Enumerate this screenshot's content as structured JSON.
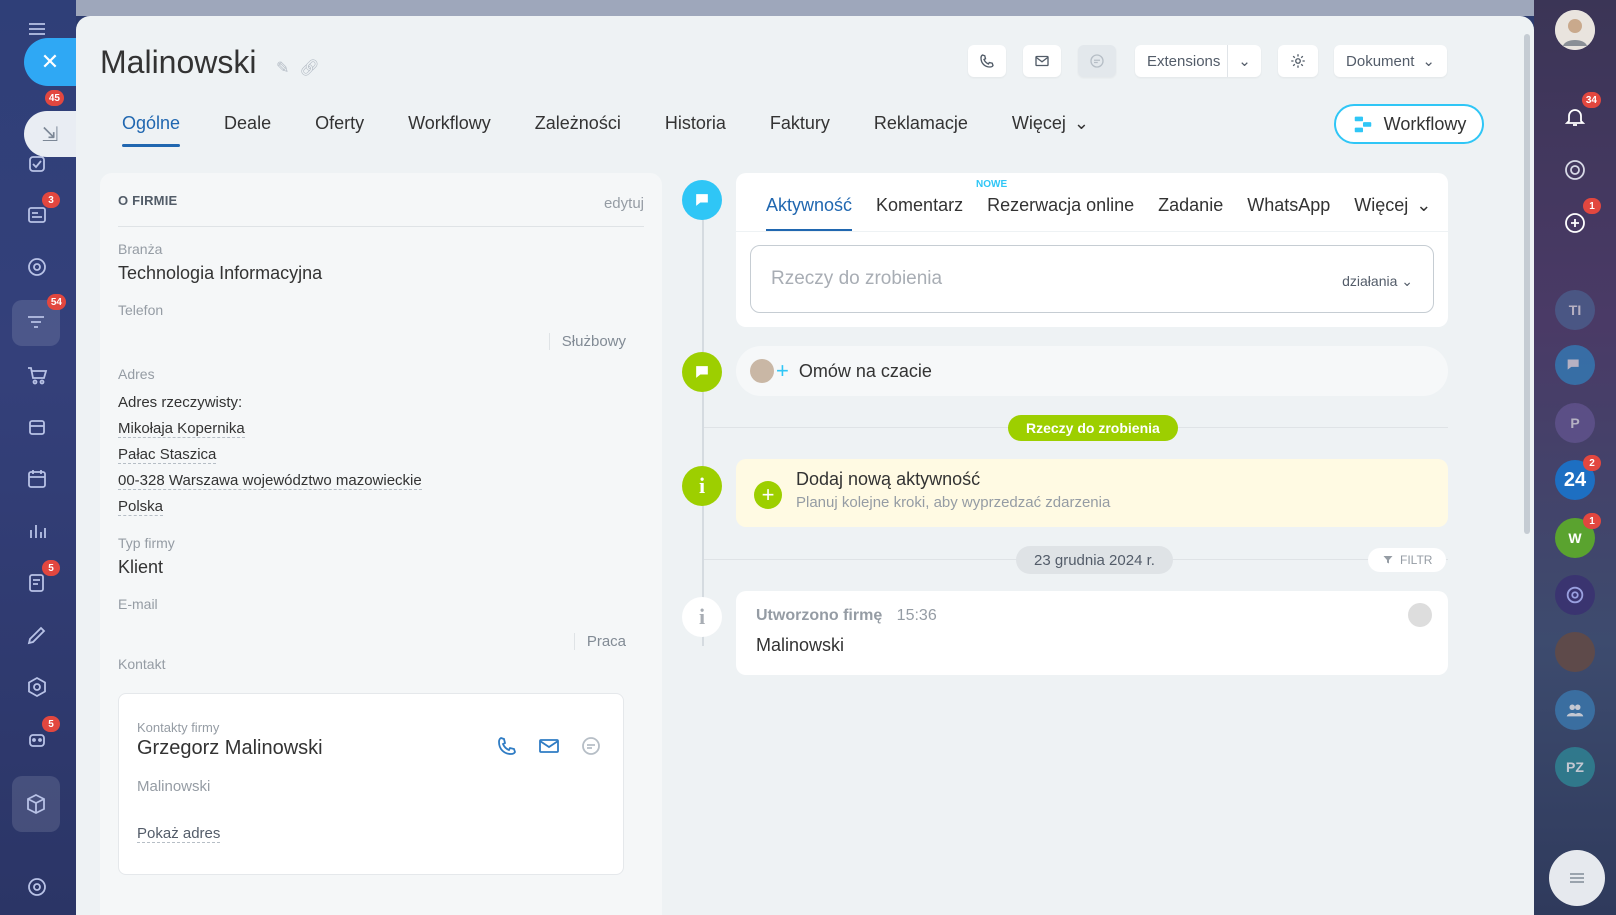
{
  "entity": {
    "title": "Malinowski"
  },
  "header": {
    "extensions_label": "Extensions",
    "document_label": "Dokument"
  },
  "tabs": [
    {
      "label": "Ogólne"
    },
    {
      "label": "Deale"
    },
    {
      "label": "Oferty"
    },
    {
      "label": "Workflowy"
    },
    {
      "label": "Zależności"
    },
    {
      "label": "Historia"
    },
    {
      "label": "Faktury"
    },
    {
      "label": "Reklamacje"
    },
    {
      "label": "Więcej"
    }
  ],
  "workflow_button": "Workflowy",
  "left_sidebar": {
    "badges": {
      "b1": "45",
      "b2": "3",
      "b3": "54",
      "b4": "5",
      "b5": "5"
    }
  },
  "right_sidebar": {
    "notif_badge": "34",
    "chat_badge": "1",
    "b24_badge": "2",
    "w_badge": "1",
    "avatars": {
      "ti": "TI",
      "p": "P",
      "b24": "24",
      "w": "W",
      "pz": "PZ"
    }
  },
  "company": {
    "section_title": "O FIRMIE",
    "edit_label": "edytuj",
    "industry_label": "Branża",
    "industry_value": "Technologia Informacyjna",
    "phone_label": "Telefon",
    "phone_type": "Służbowy",
    "address_label": "Adres",
    "address_sub": "Adres rzeczywisty:",
    "address_lines": [
      "Mikołaja Kopernika",
      "Pałac Staszica",
      "00-328 Warszawa województwo mazowieckie",
      "Polska"
    ],
    "type_label": "Typ firmy",
    "type_value": "Klient",
    "email_label": "E-mail",
    "email_type": "Praca",
    "contact_label": "Kontakt",
    "contact": {
      "box_label": "Kontakty firmy",
      "name": "Grzegorz Malinowski",
      "company": "Malinowski",
      "show_address": "Pokaż adres"
    }
  },
  "activity": {
    "tabs": [
      {
        "label": "Aktywność"
      },
      {
        "label": "Komentarz"
      },
      {
        "label": "Rezerwacja online"
      },
      {
        "label": "Zadanie"
      },
      {
        "label": "WhatsApp"
      },
      {
        "label": "Więcej"
      }
    ],
    "new_tag": "NOWE",
    "input_placeholder": "Rzeczy do zrobienia",
    "actions_label": "działania"
  },
  "chat": {
    "label": "Omów na czacie"
  },
  "todo_pill": "Rzeczy do zrobienia",
  "add_activity": {
    "title": "Dodaj nową aktywność",
    "subtitle": "Planuj kolejne kroki, aby wyprzedzać zdarzenia"
  },
  "timeline": {
    "date": "23 grudnia 2024 r.",
    "filter_label": "FILTR",
    "created_title": "Utworzono firmę",
    "created_time": "15:36",
    "created_body": "Malinowski"
  },
  "colors": {
    "accent_blue": "#2067b0",
    "cyan": "#2fc6f6",
    "green": "#9dcf00",
    "badge_red": "#e2473f"
  }
}
